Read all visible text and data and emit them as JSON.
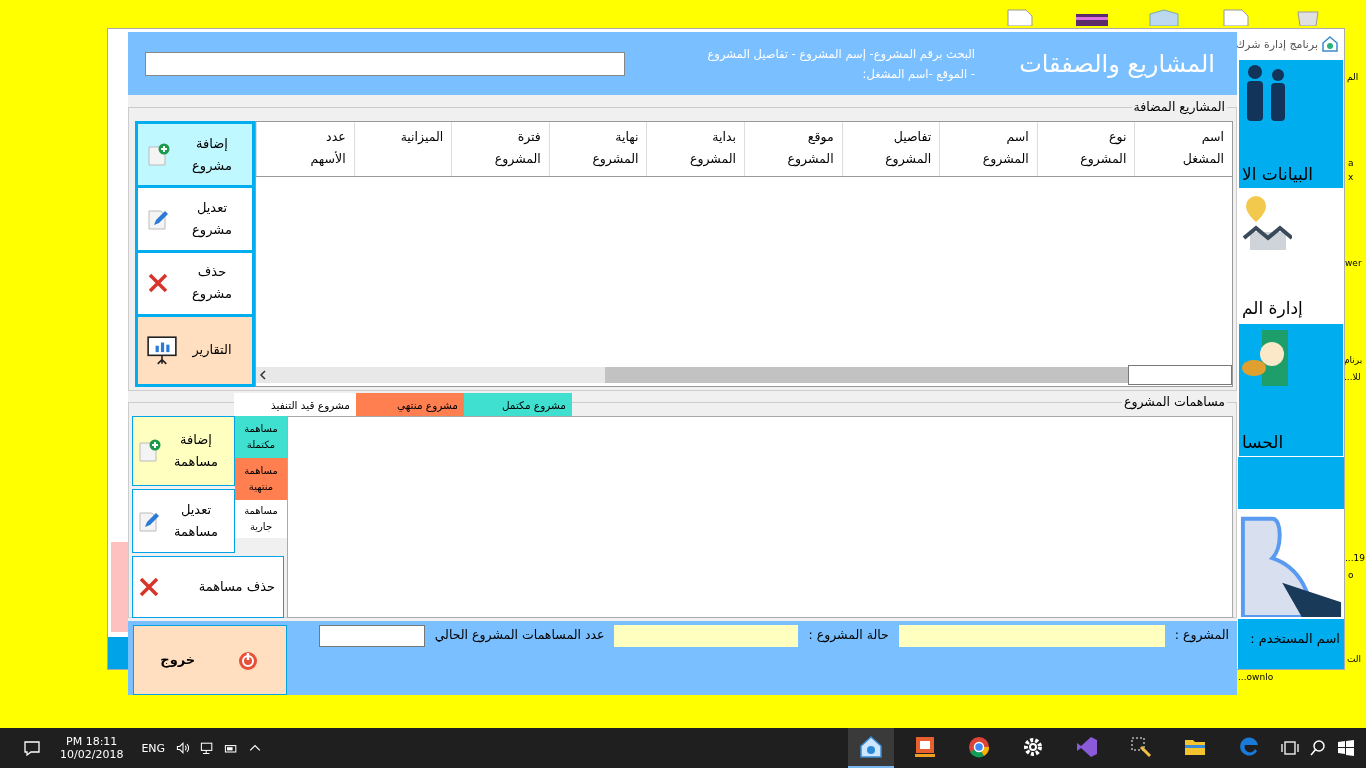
{
  "desktop": {
    "top_icons": [
      {
        "kind": "document"
      },
      {
        "kind": "archive"
      },
      {
        "kind": "box"
      },
      {
        "kind": "document"
      },
      {
        "kind": "bin"
      }
    ],
    "side_labels": [
      "الم",
      "a",
      "x",
      "wer",
      "برنام",
      "للا...",
      "19...",
      "o",
      "الت",
      "ownlo..."
    ]
  },
  "back_window": {
    "title": "برنامج إدارة شرك",
    "tiles": [
      {
        "kind": "people",
        "label": "البيانات الا",
        "color": "#00adef"
      },
      {
        "kind": "houses",
        "label": "إدارة الم",
        "color": "#ffffff"
      },
      {
        "kind": "money",
        "label": "الحسا",
        "color": "#00adef"
      },
      {
        "kind": "user",
        "color": "#ffffff"
      }
    ],
    "user_label": "اسم المستخدم :"
  },
  "dialog": {
    "title": "المشاريع والصفقات",
    "search": {
      "hint": [
        "البحث برقم المشروع- إسم المشروع - تفاصيل المشروع",
        "- الموقع -اسم المشغل:"
      ]
    },
    "projects": {
      "title": "المشاريع المضافة",
      "columns": [
        "اسم المشغل",
        "نوع المشروع",
        "اسم المشروع",
        "تفاصيل المشروع",
        "موقع المشروع",
        "بداية المشروع",
        "نهاية المشروع",
        "فترة المشروع",
        "الميزانية",
        "عدد الأسهم"
      ],
      "scroll": {
        "level": 0.6
      },
      "buttons": [
        {
          "kind": "add",
          "label": "إضافة مشروع",
          "color": "#c0f8ff"
        },
        {
          "kind": "edit",
          "label": "تعديل مشروع",
          "color": "#ffffff"
        },
        {
          "kind": "delete",
          "label": "حذف مشروع",
          "color": "#ffffff"
        },
        {
          "kind": "report",
          "label": "التقارير",
          "color": "#ffdfbf"
        }
      ]
    },
    "project_legend": [
      {
        "label": "مشروع مكتمل",
        "color": "#40e0d0"
      },
      {
        "label": "مشروع منتهي",
        "color": "#ff7f50"
      },
      {
        "label": "مشروع قيد التنفيذ",
        "color": "#ffffff"
      }
    ],
    "contributions": {
      "title": "مساهمات المشروع",
      "legend": [
        {
          "label": "مساهمة مكتملة",
          "color": "#40e0d0"
        },
        {
          "label": "مساهمة منتهية",
          "color": "#ff7f50"
        },
        {
          "label": "مساهمة جارية",
          "color": "#ffffff"
        }
      ],
      "buttons": [
        {
          "kind": "add",
          "label": "إضافة مساهمة",
          "color": "#ffffc0"
        },
        {
          "kind": "edit",
          "label": "تعديل مساهمة",
          "color": "#ffffff"
        },
        {
          "kind": "delete",
          "label": "حذف مساهمة",
          "color": "#ffffff"
        }
      ]
    },
    "footer": {
      "project_label": "المشروع :",
      "status_label": "حالة المشروع :",
      "count_label": "عدد المساهمات المشروع الحالي",
      "exit": {
        "kind": "exit",
        "label": "خروج"
      }
    }
  },
  "taskbar": {
    "time": "PM 18:11",
    "date": "10/02/2018",
    "language": "ENG",
    "apps": [
      {
        "kind": "house",
        "selected": true
      },
      {
        "kind": "ceapps",
        "selected": false
      },
      {
        "kind": "chrome",
        "selected": false
      },
      {
        "kind": "gear",
        "selected": false
      },
      {
        "kind": "vs",
        "selected": false
      },
      {
        "kind": "tool",
        "selected": false
      },
      {
        "kind": "folder",
        "selected": false
      },
      {
        "kind": "edge",
        "selected": false
      }
    ]
  }
}
